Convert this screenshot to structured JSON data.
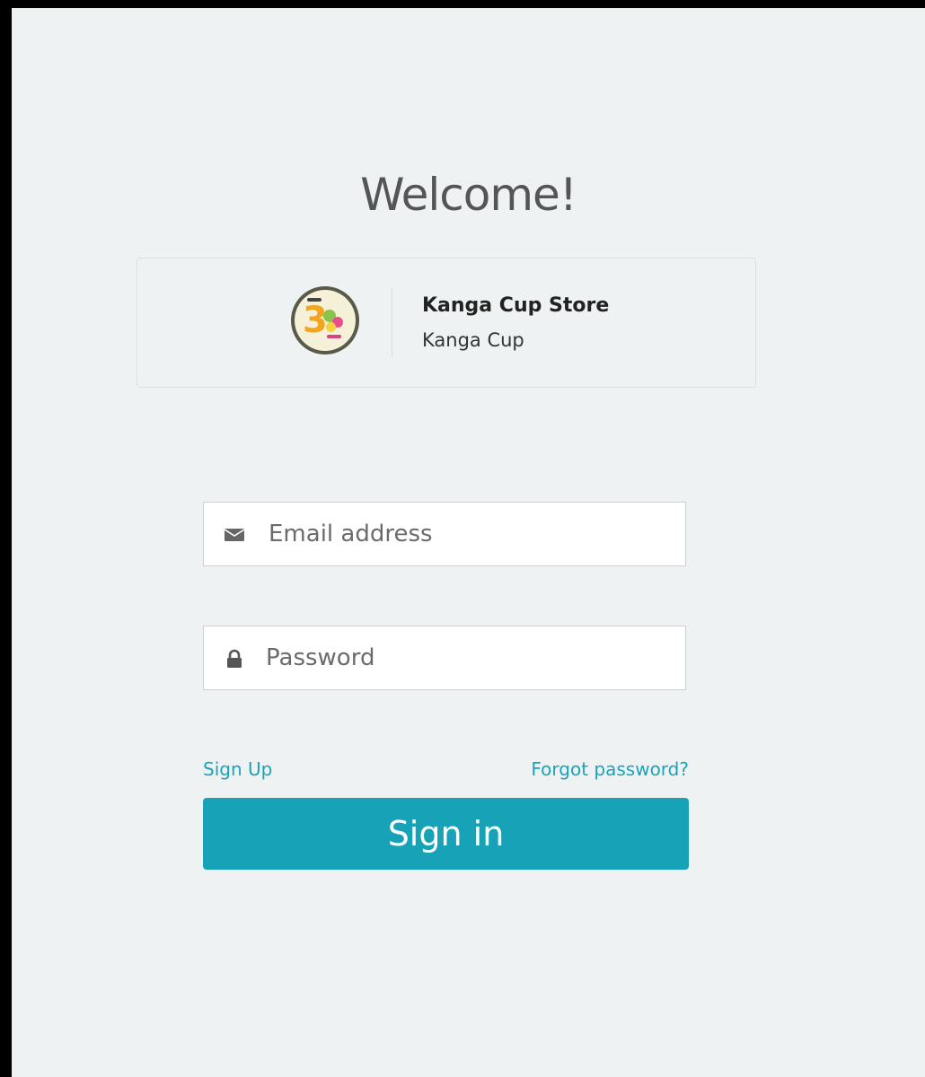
{
  "heading": "Welcome!",
  "store": {
    "name": "Kanga Cup Store",
    "subtitle": "Kanga Cup",
    "logo_icon": "kanga-cup-30-years-logo"
  },
  "form": {
    "email": {
      "placeholder": "Email address",
      "value": "",
      "icon": "envelope-icon"
    },
    "password": {
      "placeholder": "Password",
      "value": "",
      "icon": "lock-icon"
    },
    "signup_label": "Sign Up",
    "forgot_label": "Forgot password?",
    "submit_label": "Sign in"
  },
  "colors": {
    "background": "#eff2f3",
    "accent": "#18a2b8",
    "link": "#1ba3b8"
  }
}
